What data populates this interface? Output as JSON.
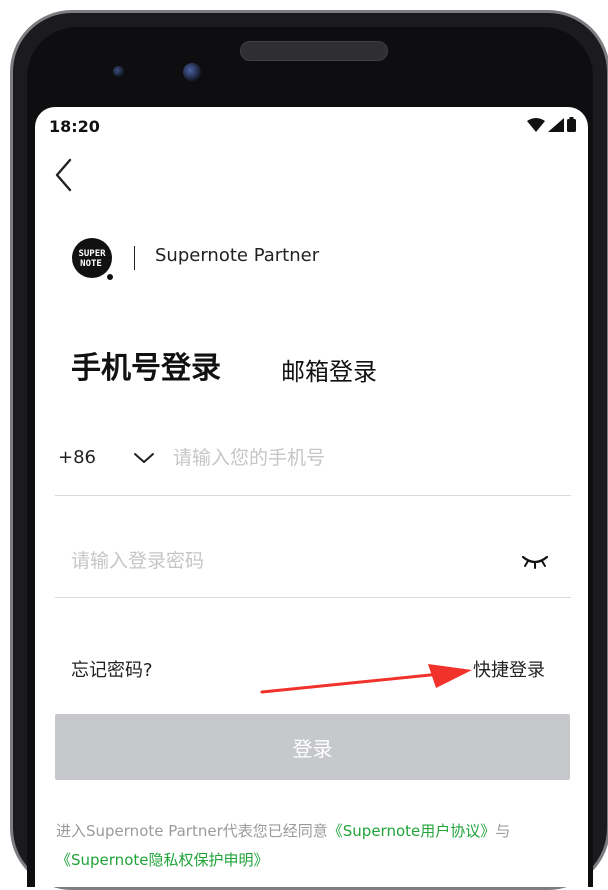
{
  "status_bar": {
    "time": "18:20",
    "icons": [
      "wifi-icon",
      "cell-signal-icon",
      "battery-icon"
    ]
  },
  "header": {
    "back_icon": "chevron-left-icon"
  },
  "brand": {
    "logo_text_top": "SUPER",
    "logo_text_bottom": "NOTE",
    "name": "Supernote Partner"
  },
  "login_tabs": {
    "active": "手机号登录",
    "inactive": "邮箱登录"
  },
  "phone_field": {
    "country_code": "+86",
    "placeholder": "请输入您的手机号",
    "value": ""
  },
  "password_field": {
    "placeholder": "请输入登录密码",
    "value": "",
    "visibility_icon": "eye-closed-icon"
  },
  "links": {
    "forgot": "忘记密码?",
    "quick_login": "快捷登录"
  },
  "login_button": {
    "label": "登录"
  },
  "agreement": {
    "prefix": "进入Supernote Partner代表您已经同意",
    "user_agreement": "《Supernote用户协议》",
    "conjunction": "与",
    "privacy": "《Supernote隐私权保护申明》"
  },
  "colors": {
    "link_green": "#20a43a",
    "button_disabled": "#c6c8cc",
    "annotation_arrow": "#f0322b"
  }
}
